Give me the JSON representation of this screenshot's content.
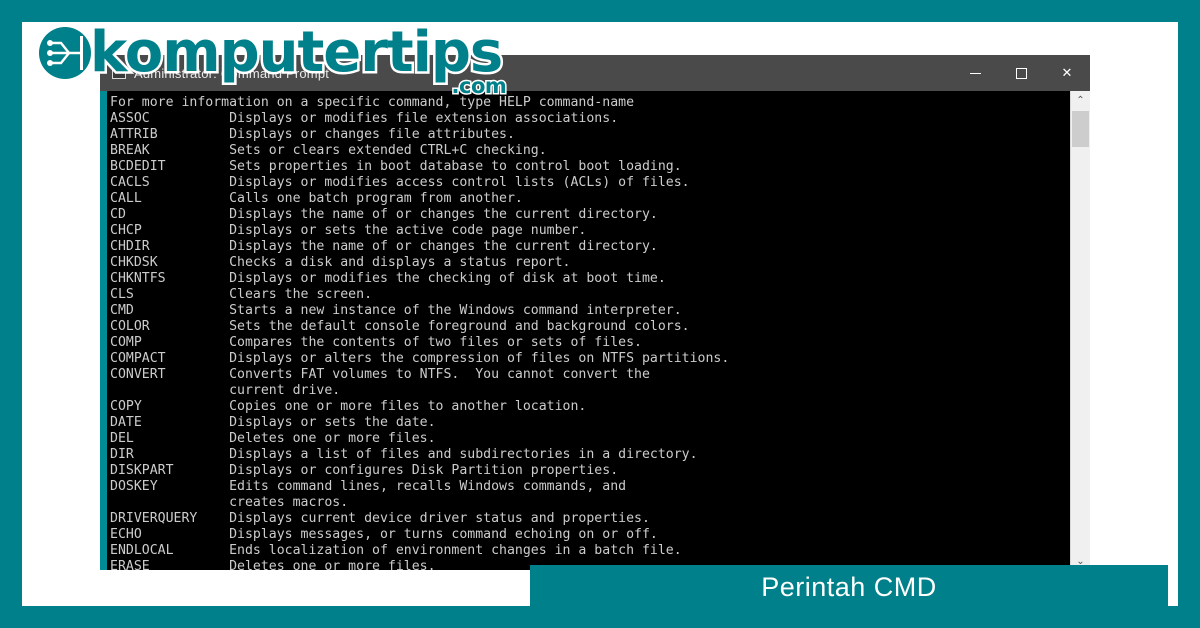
{
  "theme": {
    "frame_color": "#00808a",
    "banner_color": "#00808a",
    "console_bg": "#000000",
    "console_fg": "#cccccc",
    "titlebar_bg": "#4a4a4a"
  },
  "logo": {
    "mark_name": "komputertips-circuit-logo-icon",
    "word": "komputertips",
    "tld": ".com"
  },
  "window": {
    "title": "Administrator: Command Prompt",
    "icon_name": "console-window-icon",
    "controls": [
      {
        "name": "minimize-button",
        "glyph": "—",
        "label": "Minimize"
      },
      {
        "name": "maximize-button",
        "glyph": "□",
        "label": "Maximize"
      },
      {
        "name": "close-button",
        "glyph": "✕",
        "label": "Close"
      }
    ],
    "scrollbar": {
      "up_arrow": "⌃",
      "down_arrow": "⌄"
    }
  },
  "console": {
    "lines": [
      "For more information on a specific command, type HELP command-name",
      "ASSOC          Displays or modifies file extension associations.",
      "ATTRIB         Displays or changes file attributes.",
      "BREAK          Sets or clears extended CTRL+C checking.",
      "BCDEDIT        Sets properties in boot database to control boot loading.",
      "CACLS          Displays or modifies access control lists (ACLs) of files.",
      "CALL           Calls one batch program from another.",
      "CD             Displays the name of or changes the current directory.",
      "CHCP           Displays or sets the active code page number.",
      "CHDIR          Displays the name of or changes the current directory.",
      "CHKDSK         Checks a disk and displays a status report.",
      "CHKNTFS        Displays or modifies the checking of disk at boot time.",
      "CLS            Clears the screen.",
      "CMD            Starts a new instance of the Windows command interpreter.",
      "COLOR          Sets the default console foreground and background colors.",
      "COMP           Compares the contents of two files or sets of files.",
      "COMPACT        Displays or alters the compression of files on NTFS partitions.",
      "CONVERT        Converts FAT volumes to NTFS.  You cannot convert the",
      "               current drive.",
      "COPY           Copies one or more files to another location.",
      "DATE           Displays or sets the date.",
      "DEL            Deletes one or more files.",
      "DIR            Displays a list of files and subdirectories in a directory.",
      "DISKPART       Displays or configures Disk Partition properties.",
      "DOSKEY         Edits command lines, recalls Windows commands, and",
      "               creates macros.",
      "DRIVERQUERY    Displays current device driver status and properties.",
      "ECHO           Displays messages, or turns command echoing on or off.",
      "ENDLOCAL       Ends localization of environment changes in a batch file.",
      "ERASE          Deletes one or more files."
    ]
  },
  "banner": {
    "label": "Perintah CMD"
  }
}
